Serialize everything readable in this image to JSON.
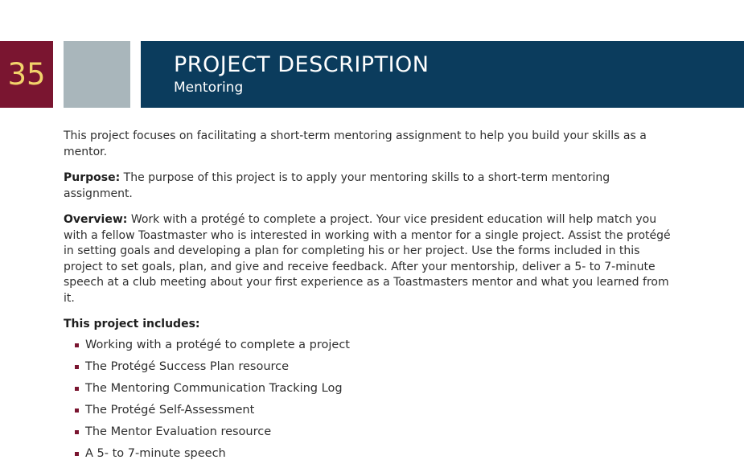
{
  "page_number": "35",
  "header": {
    "title": "PROJECT DESCRIPTION",
    "subtitle": "Mentoring"
  },
  "colors": {
    "page_number_bg": "#7a1530",
    "page_number_text": "#f2d36b",
    "gray_block": "#a9b6bb",
    "header_bg": "#0b3c5d",
    "bullet": "#7a1530"
  },
  "content": {
    "intro": "This project focuses on facilitating a short-term mentoring assignment to help you build your skills as a mentor.",
    "purpose_label": "Purpose:",
    "purpose_text": " The purpose of this project is to apply your mentoring skills to a short-term mentoring assignment.",
    "overview_label": "Overview:",
    "overview_text": " Work with a protégé to complete a project. Your vice president education will help match you with a fellow Toastmaster who is interested in working with a mentor for a single project. Assist the protégé in setting goals and developing a plan for completing his or her project. Use the forms included in this project to set goals, plan, and give and receive feedback. After your mentorship, deliver a 5- to 7-minute speech at a club meeting about your first experience as a Toastmasters mentor and what you learned from it.",
    "includes_heading": "This project includes:",
    "includes": [
      "Working with a protégé to complete a project",
      "The Protégé Success Plan resource",
      "The Mentoring Communication Tracking Log",
      "The Protégé Self-Assessment",
      "The Mentor Evaluation resource",
      "A 5- to 7-minute speech"
    ]
  }
}
